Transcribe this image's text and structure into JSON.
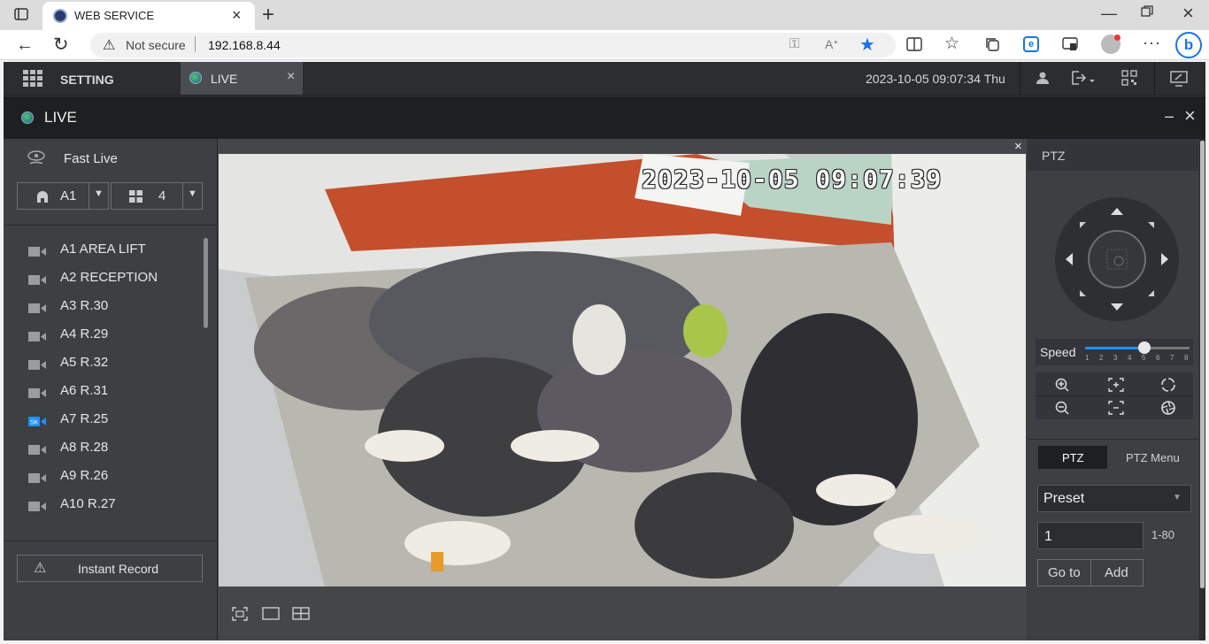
{
  "browser": {
    "tab_title": "WEB SERVICE",
    "security_label": "Not secure",
    "url": "192.168.8.44"
  },
  "app": {
    "nav": {
      "setting_label": "SETTING",
      "live_tab_label": "LIVE",
      "datetime": "2023-10-05 09:07:34 Thu"
    },
    "live_header": {
      "title": "LIVE"
    },
    "left": {
      "fast_live_label": "Fast Live",
      "area_select": "A1",
      "split_select": "4",
      "cameras": [
        {
          "label": "A1 AREA LIFT",
          "active": false
        },
        {
          "label": "A2 RECEPTION",
          "active": false
        },
        {
          "label": "A3 R.30",
          "active": false
        },
        {
          "label": "A4 R.29",
          "active": false
        },
        {
          "label": "A5 R.32",
          "active": false
        },
        {
          "label": "A6 R.31",
          "active": false
        },
        {
          "label": "A7 R.25",
          "active": true
        },
        {
          "label": "A8 R.28",
          "active": false
        },
        {
          "label": "A9 R.26",
          "active": false
        },
        {
          "label": "A10 R.27",
          "active": false
        }
      ],
      "instant_record_label": "Instant Record"
    },
    "video": {
      "osd_timestamp": "2023-10-05 09:07:39"
    },
    "ptz": {
      "title": "PTZ",
      "speed_label": "Speed",
      "speed_ticks": [
        "1",
        "2",
        "3",
        "4",
        "5",
        "6",
        "7",
        "8"
      ],
      "speed_value": 5,
      "tab_ptz": "PTZ",
      "tab_ptz_menu": "PTZ Menu",
      "preset_select": "Preset",
      "preset_value": "1",
      "preset_range": "1-80",
      "goto_label": "Go to",
      "add_label": "Add"
    },
    "colors": {
      "accent_blue": "#1e90ff",
      "active_tab_bg": "#4a4d52",
      "panel_bg": "#3d3f43"
    }
  }
}
